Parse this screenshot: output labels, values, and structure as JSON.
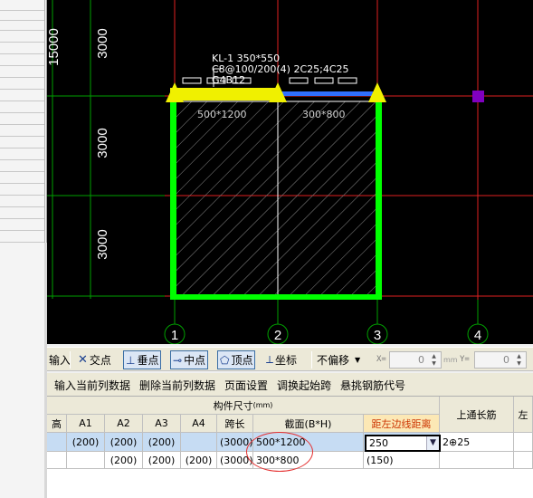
{
  "canvas": {
    "dimensions": [
      "15000",
      "3000",
      "3000",
      "3000"
    ],
    "beam_labels": [
      "KL-1 350*550",
      "C8@100/200(4) 2C25;4C25",
      "G4B12"
    ],
    "span_sections": [
      "500*1200",
      "300*800"
    ],
    "axis_numbers": [
      "1",
      "2",
      "3",
      "4"
    ],
    "colors": {
      "background": "#000000",
      "grid_line": "#00a000",
      "red_line": "#e02020",
      "column": "#00ff00",
      "beam_yellow": "#f0f000",
      "beam_blue": "#3070ff",
      "marker": "#8000c0"
    }
  },
  "toolbar": {
    "input_label": "输入",
    "intersection_label": "交点",
    "perpendicular_label": "垂点",
    "midpoint_label": "中点",
    "vertex_label": "顶点",
    "coordinate_label": "坐标",
    "offset_select": "不偏移",
    "x_label": "X=",
    "x_value": "0",
    "y_label": "Y=",
    "y_value": "0",
    "unit": "mm"
  },
  "actions": {
    "input_current_column": "输入当前列数据",
    "delete_current_column": "删除当前列数据",
    "page_setup": "页面设置",
    "swap_start_span": "调换起始跨",
    "hanger_rebar_code": "悬挑钢筋代号"
  },
  "table": {
    "group_header": "构件尺寸",
    "group_unit": "(mm)",
    "top_rebar_header": "上通长筋",
    "left_header": "左",
    "columns": [
      "高",
      "A1",
      "A2",
      "A3",
      "A4",
      "跨长",
      "截面(B*H)",
      "距左边线距离"
    ],
    "rows": [
      {
        "a1": "(200)",
        "a2": "(200)",
        "a3": "(200)",
        "a4": "",
        "span": "(3000)",
        "section": "500*1200",
        "distance": "250",
        "top_rebar": "2⊕25"
      },
      {
        "a1": "",
        "a2": "(200)",
        "a3": "(200)",
        "a4": "(200)",
        "span": "(3000)",
        "section": "300*800",
        "distance": "(150)",
        "top_rebar": ""
      }
    ]
  }
}
